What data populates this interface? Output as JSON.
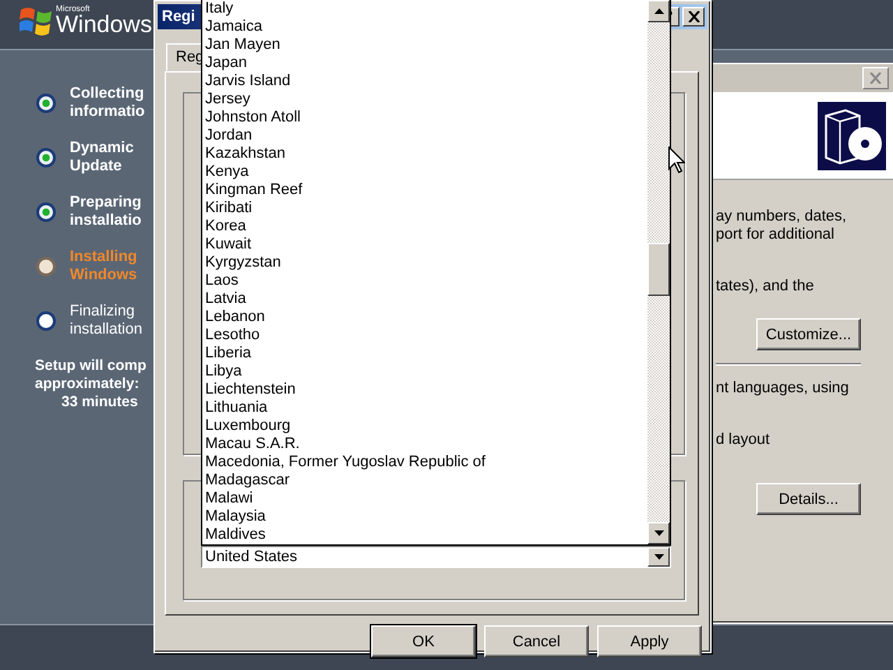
{
  "setup": {
    "logo_small": "Microsoft",
    "logo": "Windows",
    "steps": [
      {
        "lines": [
          "Collecting",
          "informatio"
        ],
        "completed": true,
        "active": false
      },
      {
        "lines": [
          "Dynamic",
          "Update"
        ],
        "completed": true,
        "active": false
      },
      {
        "lines": [
          "Preparing",
          "installatio"
        ],
        "completed": true,
        "active": false
      },
      {
        "lines": [
          "Installing",
          "Windows"
        ],
        "completed": false,
        "active": true
      },
      {
        "lines": [
          "Finalizing",
          "installation"
        ],
        "completed": false,
        "active": false
      }
    ],
    "estimate": [
      "Setup will comp",
      "approximately:",
      "33 minutes"
    ]
  },
  "back_window": {
    "texts": [
      {
        "kind": "text",
        "lines": [
          "ay numbers, dates,",
          "port for additional"
        ]
      },
      {
        "kind": "text",
        "lines": [
          "tates), and the"
        ]
      },
      {
        "kind": "button",
        "label": "Customize..."
      },
      {
        "kind": "rule"
      },
      {
        "kind": "text",
        "lines": [
          "nt languages, using"
        ]
      },
      {
        "kind": "text",
        "lines": [
          "d layout"
        ]
      },
      {
        "kind": "button",
        "label": "Details..."
      }
    ]
  },
  "dialog": {
    "title": "Regi",
    "tab": "Reg",
    "combo_value": "United States",
    "list": [
      "Italy",
      "Jamaica",
      "Jan Mayen",
      "Japan",
      "Jarvis Island",
      "Jersey",
      "Johnston Atoll",
      "Jordan",
      "Kazakhstan",
      "Kenya",
      "Kingman Reef",
      "Kiribati",
      "Korea",
      "Kuwait",
      "Kyrgyzstan",
      "Laos",
      "Latvia",
      "Lebanon",
      "Lesotho",
      "Liberia",
      "Libya",
      "Liechtenstein",
      "Lithuania",
      "Luxembourg",
      "Macau S.A.R.",
      "Macedonia, Former Yugoslav Republic of",
      "Madagascar",
      "Malawi",
      "Malaysia",
      "Maldives"
    ],
    "buttons": [
      "OK",
      "Cancel",
      "Apply"
    ]
  }
}
